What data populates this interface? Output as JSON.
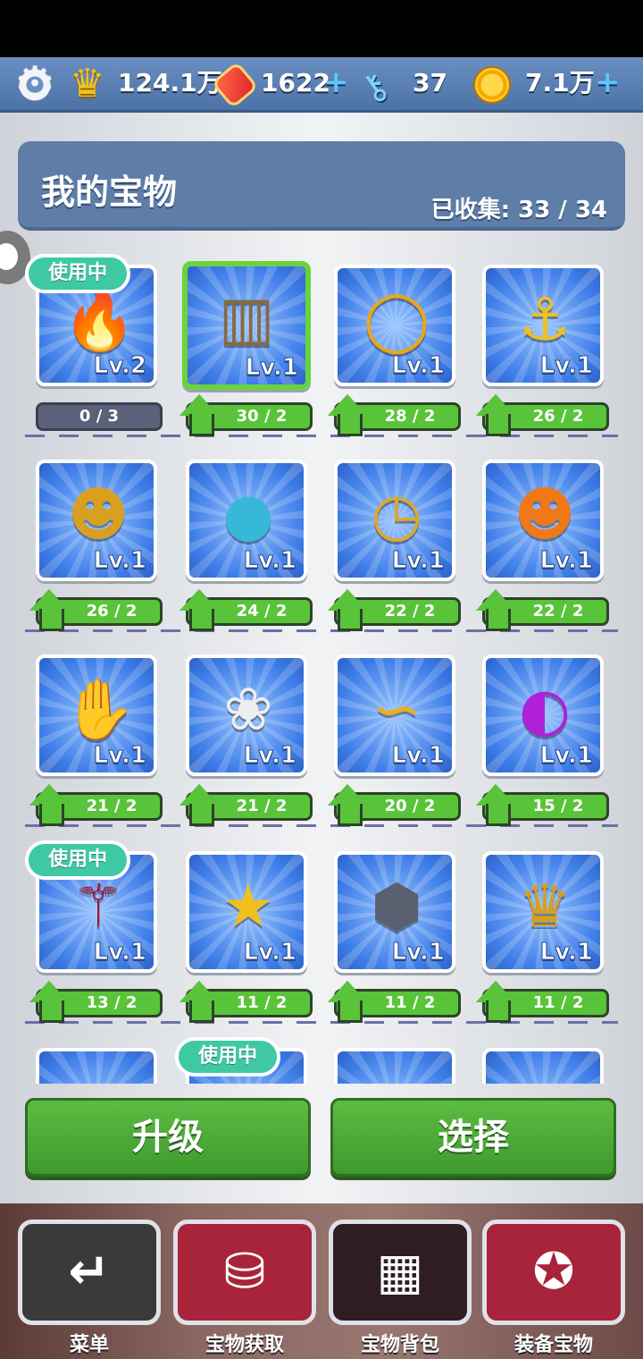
{
  "topbar": {
    "crowns": "124.1万",
    "boards": "1622",
    "keys": "37",
    "coins": "7.1万",
    "plus": "+"
  },
  "header": {
    "title": "我的宝物",
    "collected_label": "已收集:",
    "collected_value": "33 / 34"
  },
  "in_use_label": "使用中",
  "items": [
    {
      "name": "fire-board",
      "level": "Lv.2",
      "progress": "0 / 3",
      "in_use": true,
      "selected": false,
      "color": "#e23020",
      "can_upgrade": false
    },
    {
      "name": "skyscraper",
      "level": "Lv.1",
      "progress": "30 / 2",
      "in_use": false,
      "selected": true,
      "color": "#8a6a3a",
      "can_upgrade": true
    },
    {
      "name": "golden-ring",
      "level": "Lv.1",
      "progress": "28 / 2",
      "in_use": false,
      "selected": false,
      "color": "#e8a818",
      "can_upgrade": true
    },
    {
      "name": "golden-anchor",
      "level": "Lv.1",
      "progress": "26 / 2",
      "in_use": false,
      "selected": false,
      "color": "#f0c020",
      "can_upgrade": true
    },
    {
      "name": "golden-idol",
      "level": "Lv.1",
      "progress": "26 / 2",
      "in_use": false,
      "selected": false,
      "color": "#d8a020",
      "can_upgrade": true
    },
    {
      "name": "blue-egg",
      "level": "Lv.1",
      "progress": "24 / 2",
      "in_use": false,
      "selected": false,
      "color": "#38b8d8",
      "can_upgrade": true
    },
    {
      "name": "golden-watch",
      "level": "Lv.1",
      "progress": "22 / 2",
      "in_use": false,
      "selected": false,
      "color": "#e0a828",
      "can_upgrade": true
    },
    {
      "name": "pumpkin",
      "level": "Lv.1",
      "progress": "22 / 2",
      "in_use": false,
      "selected": false,
      "color": "#f07818",
      "can_upgrade": true
    },
    {
      "name": "golden-glove",
      "level": "Lv.1",
      "progress": "21 / 2",
      "in_use": false,
      "selected": false,
      "color": "#f0c028",
      "can_upgrade": true
    },
    {
      "name": "white-rabbit",
      "level": "Lv.1",
      "progress": "21 / 2",
      "in_use": false,
      "selected": false,
      "color": "#eeeeee",
      "can_upgrade": true
    },
    {
      "name": "golden-lamp",
      "level": "Lv.1",
      "progress": "20 / 2",
      "in_use": false,
      "selected": false,
      "color": "#e8b020",
      "can_upgrade": true
    },
    {
      "name": "purple-helmet",
      "level": "Lv.1",
      "progress": "15 / 2",
      "in_use": false,
      "selected": false,
      "color": "#b020d8",
      "can_upgrade": true
    },
    {
      "name": "magic-wand",
      "level": "Lv.1",
      "progress": "13 / 2",
      "in_use": true,
      "selected": false,
      "color": "#a01830",
      "can_upgrade": true
    },
    {
      "name": "star-necklace",
      "level": "Lv.1",
      "progress": "11 / 2",
      "in_use": false,
      "selected": false,
      "color": "#f0c020",
      "can_upgrade": true
    },
    {
      "name": "hex-gadget",
      "level": "Lv.1",
      "progress": "11 / 2",
      "in_use": false,
      "selected": false,
      "color": "#5a6070",
      "can_upgrade": true
    },
    {
      "name": "golden-crown",
      "level": "Lv.1",
      "progress": "11 / 2",
      "in_use": false,
      "selected": false,
      "color": "#d8a020",
      "can_upgrade": true
    },
    {
      "name": "item-17",
      "level": "",
      "progress": "",
      "in_use": false,
      "selected": false,
      "color": "#e8c020",
      "can_upgrade": true
    },
    {
      "name": "item-18",
      "level": "",
      "progress": "",
      "in_use": true,
      "selected": false,
      "color": "#3a9a3a",
      "can_upgrade": true
    },
    {
      "name": "item-19",
      "level": "",
      "progress": "",
      "in_use": false,
      "selected": false,
      "color": "#d8b020",
      "can_upgrade": true
    },
    {
      "name": "item-20",
      "level": "",
      "progress": "",
      "in_use": false,
      "selected": false,
      "color": "#b04ad0",
      "can_upgrade": true
    }
  ],
  "buttons": {
    "upgrade": "升级",
    "select": "选择"
  },
  "nav": [
    {
      "label": "菜单",
      "icon": "return-icon",
      "bg": "#3a3a3a"
    },
    {
      "label": "宝物获取",
      "icon": "chest-icon",
      "bg": "#a8243a"
    },
    {
      "label": "宝物背包",
      "icon": "grid-check-icon",
      "bg": "#2e1e22"
    },
    {
      "label": "装备宝物",
      "icon": "equip-star-icon",
      "bg": "#a8243a"
    }
  ]
}
